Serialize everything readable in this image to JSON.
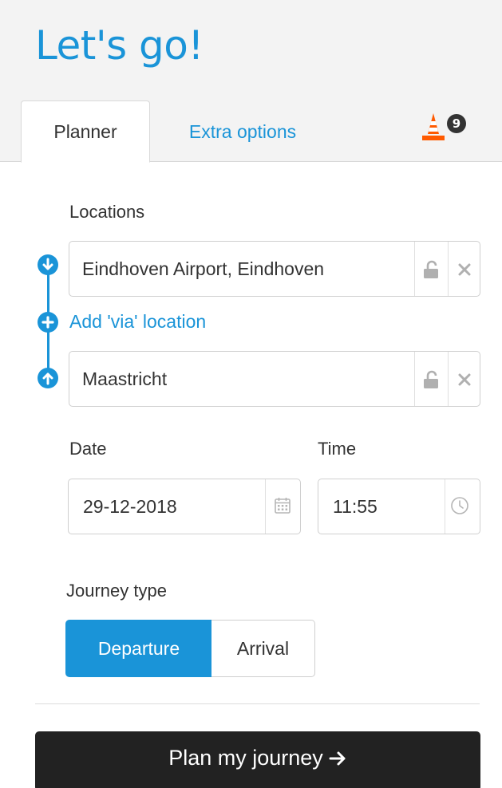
{
  "header": {
    "title": "Let's go!",
    "tabs": [
      {
        "label": "Planner",
        "active": true
      },
      {
        "label": "Extra options",
        "active": false
      }
    ],
    "disruptions": {
      "icon": "traffic-cone-icon",
      "count": "9"
    }
  },
  "locations": {
    "label": "Locations",
    "from": {
      "value": "Eindhoven Airport, Eindhoven",
      "icons": [
        "lock-open-icon",
        "close-icon"
      ]
    },
    "via_link": "Add 'via' location",
    "to": {
      "value": "Maastricht",
      "icons": [
        "lock-open-icon",
        "close-icon"
      ]
    }
  },
  "date": {
    "label": "Date",
    "value": "29-12-2018",
    "icon": "calendar-icon"
  },
  "time": {
    "label": "Time",
    "value": "11:55",
    "icon": "clock-icon"
  },
  "journey_type": {
    "label": "Journey type",
    "options": [
      {
        "label": "Departure",
        "selected": true
      },
      {
        "label": "Arrival",
        "selected": false
      }
    ]
  },
  "plan_button": {
    "label": "Plan my journey",
    "icon": "arrow-right-icon"
  },
  "colors": {
    "accent": "#1a94d8",
    "dark": "#222222",
    "cone": "#ff5a00"
  }
}
